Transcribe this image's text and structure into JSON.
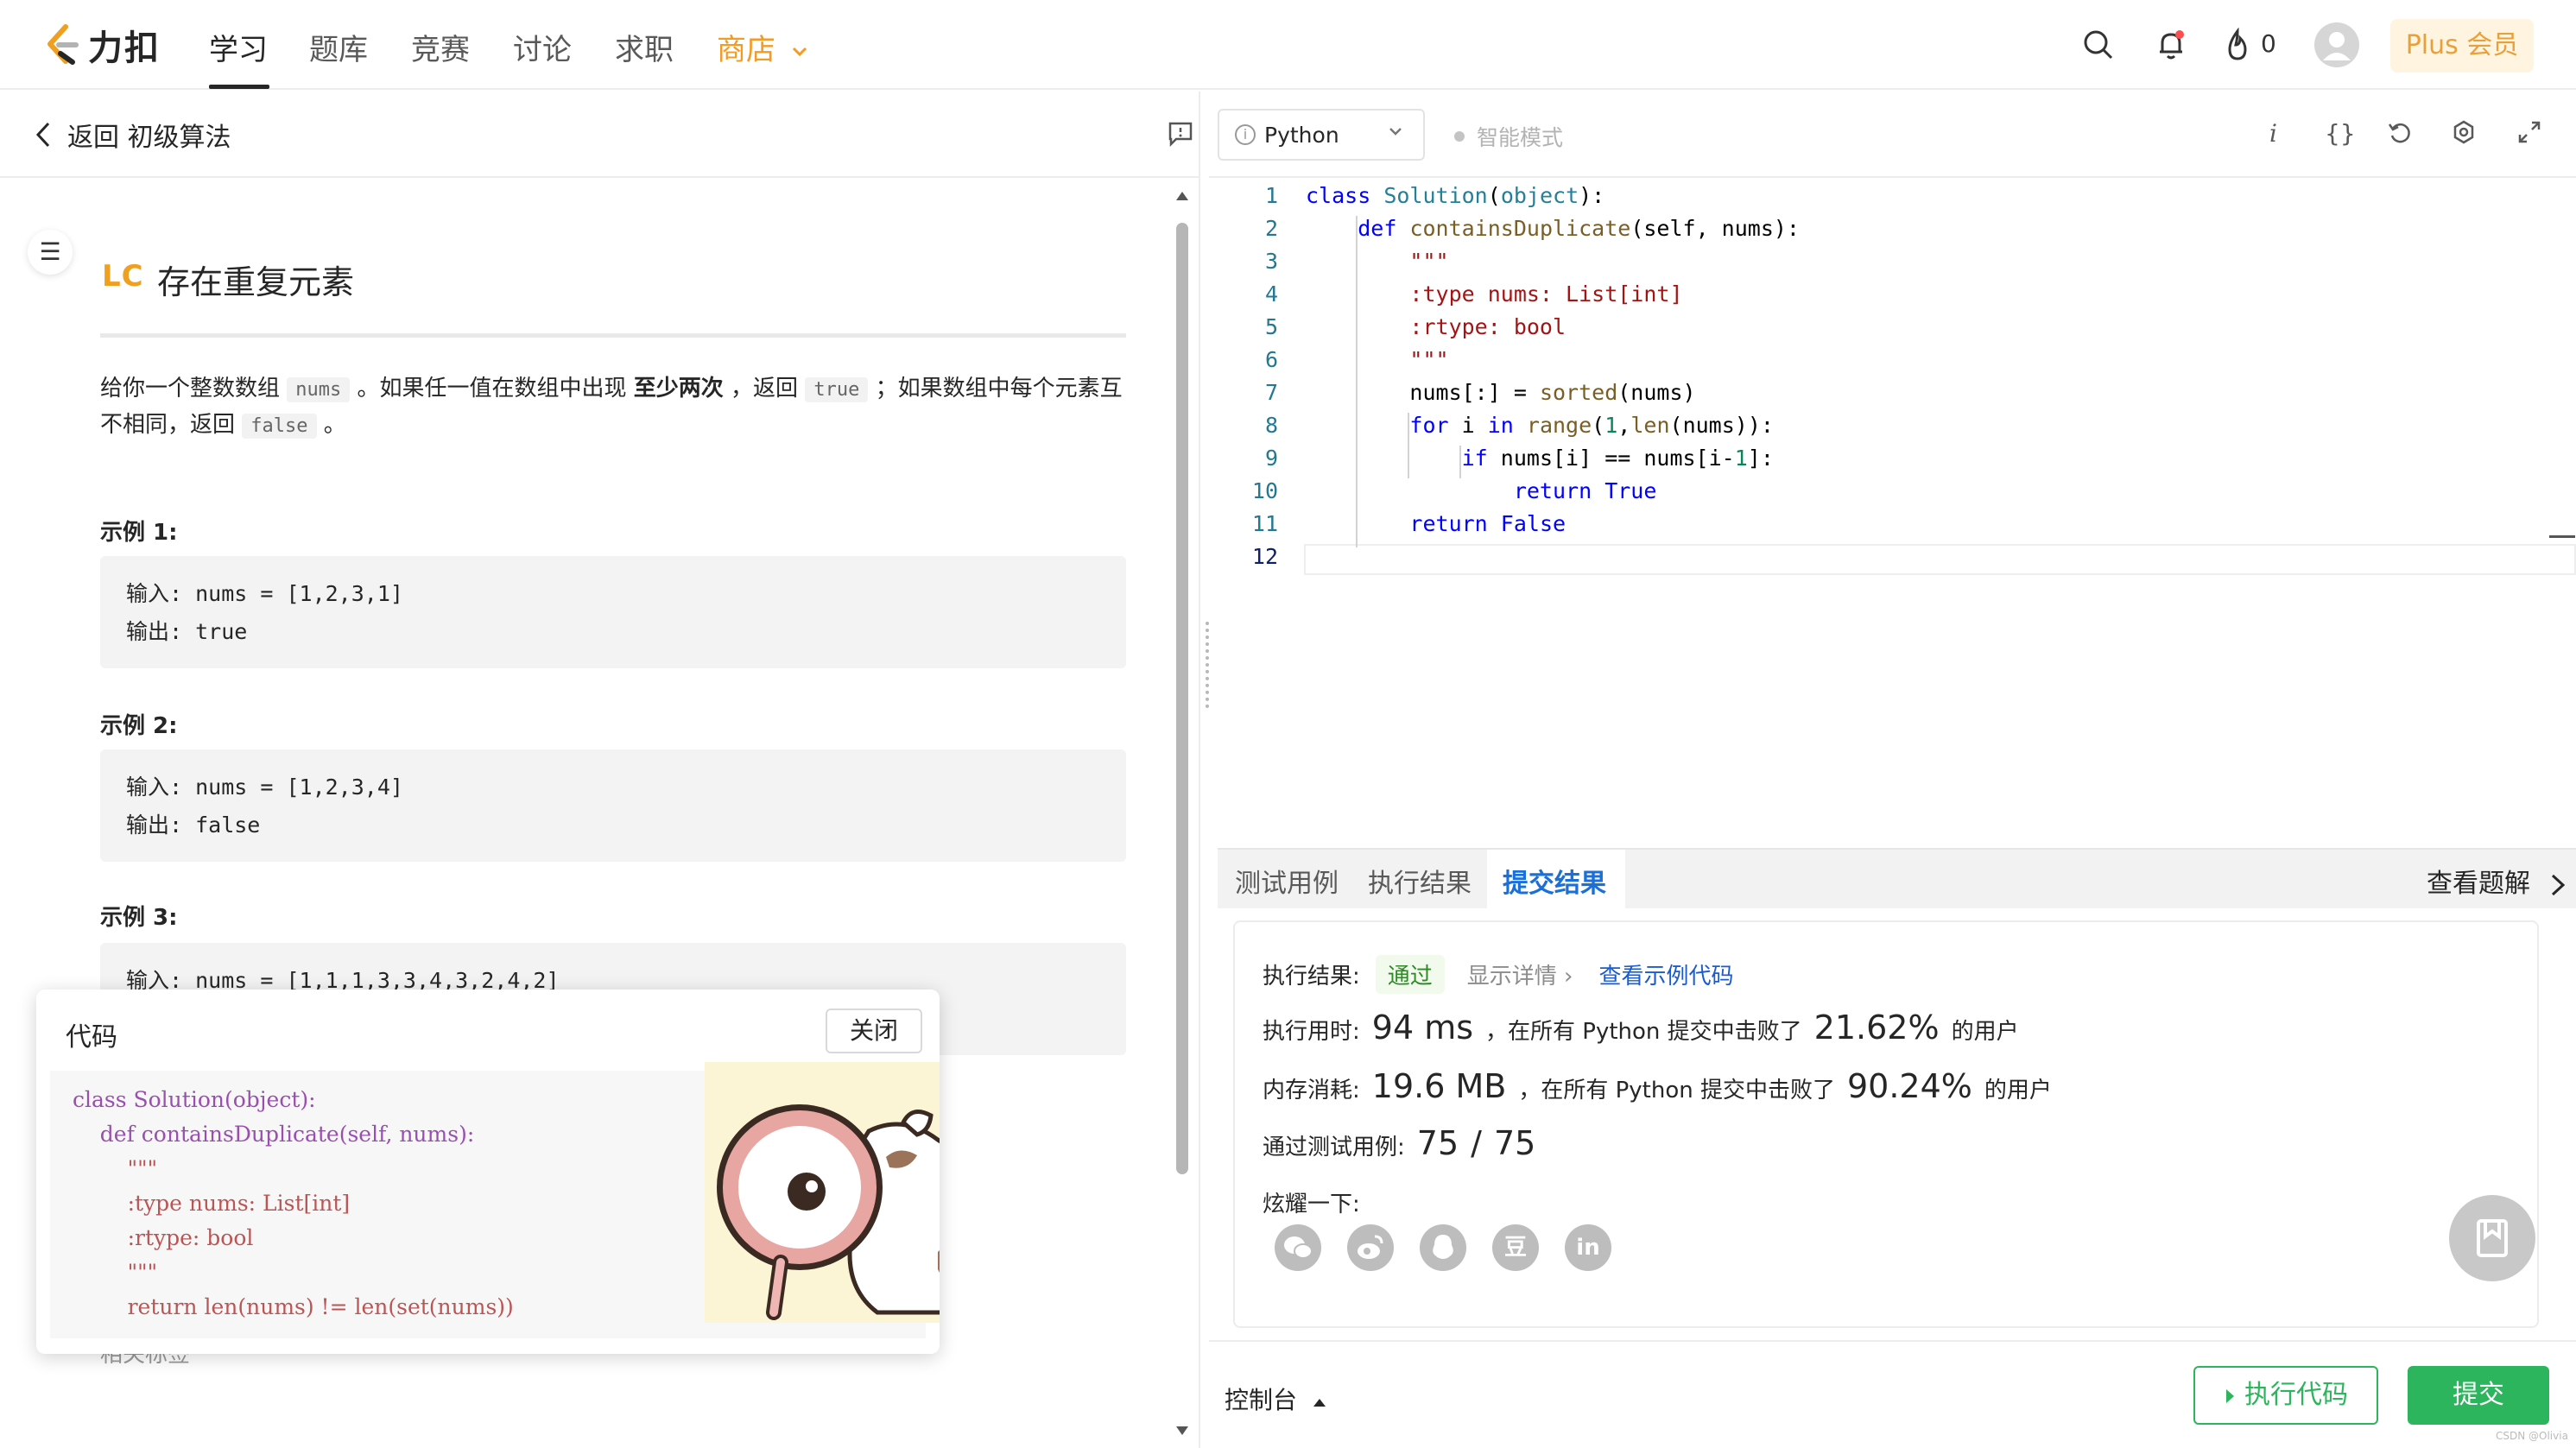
{
  "nav": {
    "brand": "力扣",
    "tabs": [
      "学习",
      "题库",
      "竞赛",
      "讨论",
      "求职"
    ],
    "shop": "商店",
    "streak_count": "0",
    "plus_label": "Plus 会员"
  },
  "problem": {
    "back_label": "返回 初级算法",
    "badge": "LC",
    "title": "存在重复元素",
    "desc": {
      "p1": "给你一个整数数组 ",
      "nums": "nums",
      "p2": " 。如果任一值在数组中出现 ",
      "bold": "至少两次",
      "p3": " ，返回 ",
      "true": "true",
      "p4": " ；如果数组中每个元素互不相同，返回 ",
      "false": "false",
      "p5": " 。"
    },
    "examples": [
      {
        "label": "示例 1:",
        "input": "输入: nums = [1,2,3,1]",
        "output": "输出: true"
      },
      {
        "label": "示例 2:",
        "input": "输入: nums = [1,2,3,4]",
        "output": "输出: false"
      },
      {
        "label": "示例 3:",
        "input": "输入: nums = [1,1,1,3,3,4,3,2,4,2]"
      }
    ],
    "related_partial": "相关标签"
  },
  "popup": {
    "title": "代码",
    "close": "关闭",
    "code_lines": [
      "class Solution(object):",
      "    def containsDuplicate(self, nums):",
      "        \"\"\"",
      "        :type nums: List[int]",
      "        :rtype: bool",
      "        \"\"\"",
      "        return len(nums) != len(set(nums))"
    ]
  },
  "editor": {
    "language": "Python",
    "smart_mode": "智能模式",
    "line_numbers": [
      "1",
      "2",
      "3",
      "4",
      "5",
      "6",
      "7",
      "8",
      "9",
      "10",
      "11",
      "12"
    ]
  },
  "results": {
    "tabs": [
      "测试用例",
      "执行结果",
      "提交结果"
    ],
    "view_solution": "查看题解",
    "exec_label": "执行结果:",
    "pass": "通过",
    "details": "显示详情",
    "example_code": "查看示例代码",
    "time_label": "执行用时:",
    "time_value": "94 ms",
    "time_mid": "，在所有 Python 提交中击败了",
    "time_pct": "21.62%",
    "users": "的用户",
    "mem_label": "内存消耗:",
    "mem_value": "19.6 MB",
    "mem_mid": "，在所有 Python 提交中击败了",
    "mem_pct": "90.24%",
    "tests_label": "通过测试用例:",
    "tests_passed": "75",
    "tests_total": "75",
    "share_label": "炫耀一下:",
    "share_icons": [
      "wechat-icon",
      "weibo-icon",
      "qq-icon",
      "douban-icon",
      "linkedin-icon"
    ],
    "douban_glyph": "豆",
    "linkedin_glyph": "in"
  },
  "bottom": {
    "console": "控制台",
    "run": "执行代码",
    "submit": "提交"
  },
  "watermark": "CSDN @Olivia",
  "colors": {
    "accent_green": "#2db55d",
    "link_blue": "#1a5cd0",
    "shop_orange": "#f59a23"
  }
}
